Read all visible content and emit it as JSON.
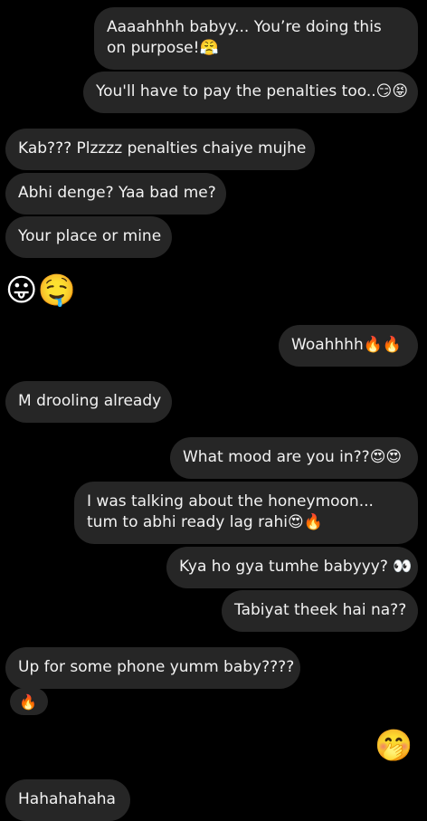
{
  "messages": [
    {
      "side": "sent",
      "text": "Aaaahhhh babyy... You’re doing this on purpose!😤"
    },
    {
      "side": "sent",
      "text": "You'll have to pay the penalties too..😏😝"
    },
    {
      "side": "received",
      "text": "Kab??? Plzzzz penalties chaiye mujhe"
    },
    {
      "side": "received",
      "text": "Abhi denge? Yaa bad me?"
    },
    {
      "side": "received",
      "text": "Your place or mine"
    },
    {
      "side": "received",
      "text": "😛🤤"
    },
    {
      "side": "sent",
      "text": "Woahhhh🔥🔥"
    },
    {
      "side": "received",
      "text": "M drooling already"
    },
    {
      "side": "sent",
      "text": "What mood are you in??😍😍"
    },
    {
      "side": "sent",
      "text": "I was talking about the honeymoon... tum to abhi ready lag rahi😍🔥"
    },
    {
      "side": "sent",
      "text": "Kya ho gya tumhe babyyy? 👀"
    },
    {
      "side": "sent",
      "text": "Tabiyat theek hai na??"
    },
    {
      "side": "received",
      "text": "Up for some phone yumm baby????"
    },
    {
      "side": "received",
      "text": "🔥"
    },
    {
      "side": "sent",
      "text": "🤭"
    },
    {
      "side": "received",
      "text": "Hahahahaha"
    }
  ]
}
